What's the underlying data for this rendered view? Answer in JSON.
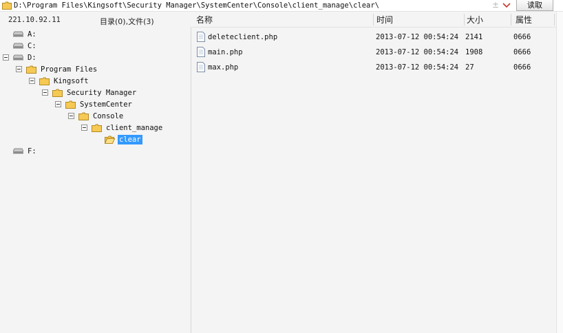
{
  "path_bar": {
    "path": "D:\\Program Files\\Kingsoft\\Security Manager\\SystemCenter\\Console\\client_manage\\clear\\",
    "extra_symbol": "±",
    "read_button": "读取"
  },
  "left_header": {
    "server_ip": "221.10.92.11",
    "dir_summary": "目录(0),文件(3)"
  },
  "tree": {
    "drive_a": "A:",
    "drive_c": "C:",
    "drive_d": "D:",
    "program_files": "Program Files",
    "kingsoft": "Kingsoft",
    "security_manager": "Security Manager",
    "system_center": "SystemCenter",
    "console": "Console",
    "client_manage": "client_manage",
    "clear": "clear",
    "drive_f": "F:"
  },
  "columns": {
    "name": "名称",
    "time": "时间",
    "size": "大小",
    "attr": "属性"
  },
  "files": [
    {
      "name": "deleteclient.php",
      "time": "2013-07-12 00:54:24",
      "size": "2141",
      "attr": "0666"
    },
    {
      "name": "main.php",
      "time": "2013-07-12 00:54:24",
      "size": "1908",
      "attr": "0666"
    },
    {
      "name": "max.php",
      "time": "2013-07-12 00:54:24",
      "size": "27",
      "attr": "0666"
    }
  ],
  "colors": {
    "selection": "#3399ff",
    "folder": "#f6c955"
  },
  "icons": {
    "path": "folder-icon",
    "drive": "drive-icon",
    "folder": "folder-icon",
    "file": "file-icon",
    "dropdown": "chevron-down-icon"
  }
}
